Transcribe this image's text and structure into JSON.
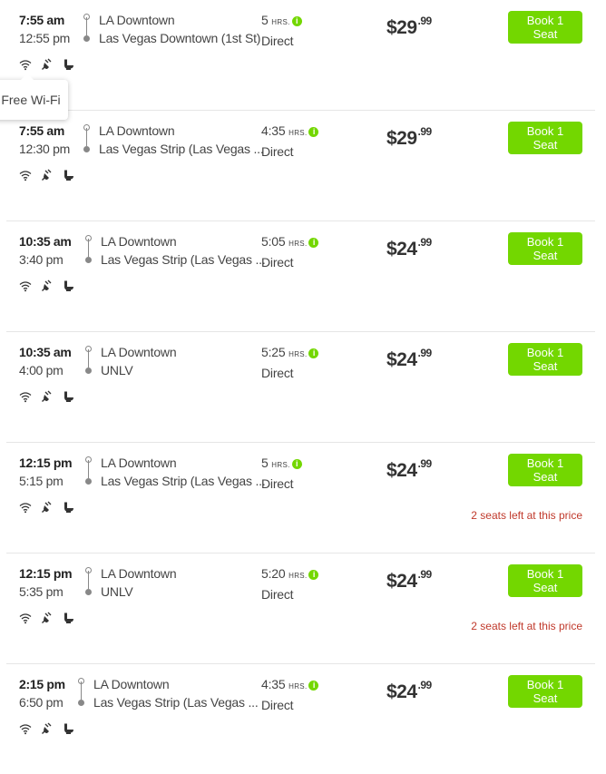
{
  "colors": {
    "accent": "#73d700",
    "warning": "#c0392b"
  },
  "tooltip": {
    "label": "Free Wi-Fi"
  },
  "hrs_unit": "HRS.",
  "rides": [
    {
      "dep": "7:55 am",
      "arr": "12:55 pm",
      "from": "LA Downtown",
      "to": "Las Vegas Downtown (1st St)",
      "dur": "5",
      "has_hrs": true,
      "transfer": "Direct",
      "price": "$29",
      "cents": ".99",
      "book": "Book 1 Seat",
      "seats": ""
    },
    {
      "dep": "7:55 am",
      "arr": "12:30 pm",
      "from": "LA Downtown",
      "to": "Las Vegas Strip (Las Vegas ...",
      "dur": "4:35",
      "has_hrs": true,
      "transfer": "Direct",
      "price": "$29",
      "cents": ".99",
      "book": "Book 1 Seat",
      "seats": ""
    },
    {
      "dep": "10:35 am",
      "arr": "3:40 pm",
      "from": "LA Downtown",
      "to": "Las Vegas Strip (Las Vegas ...",
      "dur": "5:05",
      "has_hrs": true,
      "transfer": "Direct",
      "price": "$24",
      "cents": ".99",
      "book": "Book 1 Seat",
      "seats": ""
    },
    {
      "dep": "10:35 am",
      "arr": "4:00 pm",
      "from": "LA Downtown",
      "to": "UNLV",
      "dur": "5:25",
      "has_hrs": true,
      "transfer": "Direct",
      "price": "$24",
      "cents": ".99",
      "book": "Book 1 Seat",
      "seats": ""
    },
    {
      "dep": "12:15 pm",
      "arr": "5:15 pm",
      "from": "LA Downtown",
      "to": "Las Vegas Strip (Las Vegas ...",
      "dur": "5",
      "has_hrs": true,
      "transfer": "Direct",
      "price": "$24",
      "cents": ".99",
      "book": "Book 1 Seat",
      "seats": "2 seats left at this price"
    },
    {
      "dep": "12:15 pm",
      "arr": "5:35 pm",
      "from": "LA Downtown",
      "to": "UNLV",
      "dur": "5:20",
      "has_hrs": true,
      "transfer": "Direct",
      "price": "$24",
      "cents": ".99",
      "book": "Book 1 Seat",
      "seats": "2 seats left at this price"
    },
    {
      "dep": "2:15 pm",
      "arr": "6:50 pm",
      "from": "LA Downtown",
      "to": "Las Vegas Strip (Las Vegas ...",
      "dur": "4:35",
      "has_hrs": true,
      "transfer": "Direct",
      "price": "$24",
      "cents": ".99",
      "book": "Book 1 Seat",
      "seats": ""
    }
  ],
  "amenities": [
    "wifi-icon",
    "power-plug-icon",
    "toilet-icon"
  ]
}
